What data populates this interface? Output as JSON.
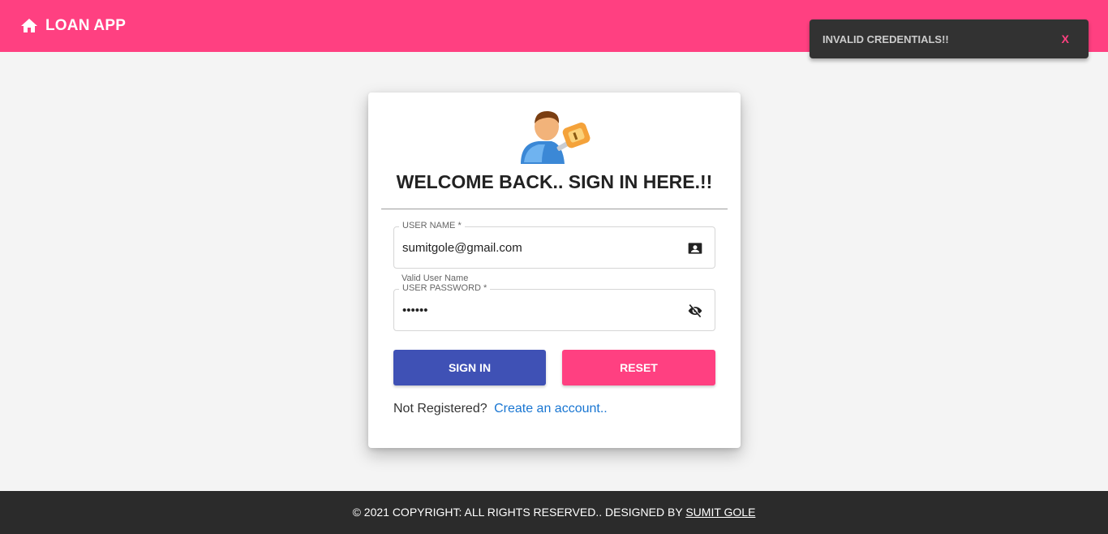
{
  "header": {
    "title": "LOAN APP",
    "icon": "home-icon",
    "color": "#ff4081"
  },
  "toast": {
    "message": "INVALID CREDENTIALS!!",
    "close_label": "X"
  },
  "login": {
    "heading": "WELCOME BACK.. SIGN IN HERE.!!",
    "username": {
      "label": "USER NAME *",
      "value": "sumitgole@gmail.com",
      "hint": "Valid User Name",
      "icon": "contact-card-icon"
    },
    "password": {
      "label": "USER PASSWORD *",
      "value": "••••••",
      "icon": "eye-off-icon"
    },
    "signin_label": "SIGN IN",
    "reset_label": "RESET",
    "register_prompt": "Not Registered?",
    "register_link": "Create an account..",
    "signin_color": "#3f51b5",
    "reset_color": "#ff4081"
  },
  "footer": {
    "text": "© 2021 COPYRIGHT: ALL RIGHTS RESERVED.. DESIGNED BY",
    "author": "SUMIT GOLE"
  }
}
